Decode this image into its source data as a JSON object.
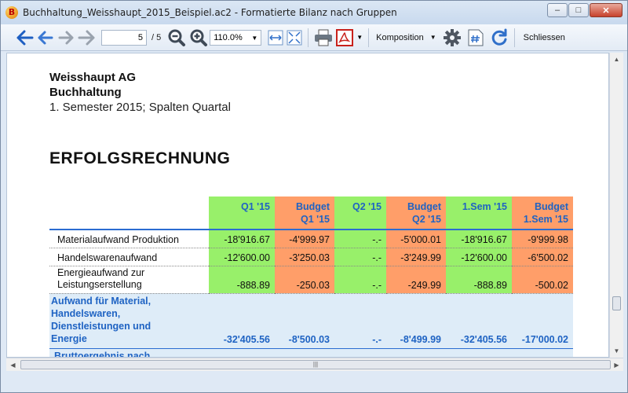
{
  "window": {
    "title": "Buchhaltung_Weisshaupt_2015_Beispiel.ac2 - Formatierte Bilanz nach Gruppen",
    "app_icon_letter": "B",
    "minimize_label": "–",
    "maximize_label": "□",
    "close_label": "✕"
  },
  "toolbar": {
    "page_current": "5",
    "page_total": "/ 5",
    "zoom": "110.0%",
    "composition_label": "Komposition",
    "close_label": "Schliessen"
  },
  "document": {
    "company": "Weisshaupt AG",
    "department": "Buchhaltung",
    "period": "1. Semester 2015; Spalten Quartal",
    "heading": "ERFOLGSRECHNUNG",
    "columns": [
      "Q1 '15",
      "Budget\nQ1 '15",
      "Q2 '15",
      "Budget\nQ2 '15",
      "1.Sem '15",
      "Budget\n1.Sem '15"
    ],
    "rows": [
      {
        "label": "Materialaufwand Produktion",
        "values": [
          "-18'916.67",
          "-4'999.97",
          "-.-",
          "-5'000.01",
          "-18'916.67",
          "-9'999.98"
        ]
      },
      {
        "label": "Handelswarenaufwand",
        "values": [
          "-12'600.00",
          "-3'250.03",
          "-.-",
          "-3'249.99",
          "-12'600.00",
          "-6'500.02"
        ]
      },
      {
        "label": "Energieaufwand zur\nLeistungserstellung",
        "values": [
          "-888.89",
          "-250.03",
          "-.-",
          "-249.99",
          "-888.89",
          "-500.02"
        ]
      }
    ],
    "total": {
      "label": "Aufwand für Material,\nHandelswaren,\nDienstleistungen und\nEnergie",
      "values": [
        "-32'405.56",
        "-8'500.03",
        "-.-",
        "-8'499.99",
        "-32'405.56",
        "-17'000.02"
      ]
    },
    "next_section_label": "Bruttoergebnis nach"
  },
  "colors": {
    "actual_column": "#98f06a",
    "budget_column": "#ff9e69",
    "total_row": "#deecf8",
    "accent_text": "#1f63c3"
  },
  "icons": [
    "back-icon",
    "prev-page-icon",
    "next-page-icon",
    "forward-icon",
    "zoom-out-icon",
    "zoom-in-icon",
    "fit-width-icon",
    "fit-page-icon",
    "print-icon",
    "pdf-icon",
    "settings-icon",
    "page-number-icon",
    "refresh-icon"
  ]
}
